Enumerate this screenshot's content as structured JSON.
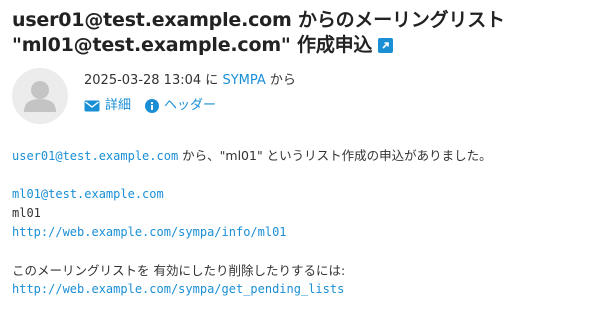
{
  "subject": {
    "line1": "user01@test.example.com からのメーリングリスト",
    "line2": "\"ml01@test.example.com\" 作成申込",
    "icon": "external-link-icon"
  },
  "header": {
    "avatar_icon": "user-avatar-icon",
    "date": "2025-03-28 13:04",
    "prefix_ni": "に",
    "sender_name": "SYMPA",
    "suffix_kara": "から",
    "details_label": "詳細",
    "details_icon": "envelope-icon",
    "headers_label": "ヘッダー",
    "headers_icon": "info-icon"
  },
  "body": {
    "intro_email": "user01@test.example.com",
    "intro_text": " から、\"ml01\" というリスト作成の申込がありました。",
    "list_email": "ml01@test.example.com",
    "list_name": "ml01",
    "info_url": "http://web.example.com/sympa/info/ml01",
    "action_text": "このメーリングリストを 有効にしたり削除したりするには:",
    "pending_url": "http://web.example.com/sympa/get_pending_lists"
  },
  "colors": {
    "link": "#1a8fd6",
    "text": "#333333",
    "avatar_bg": "#ececec"
  }
}
